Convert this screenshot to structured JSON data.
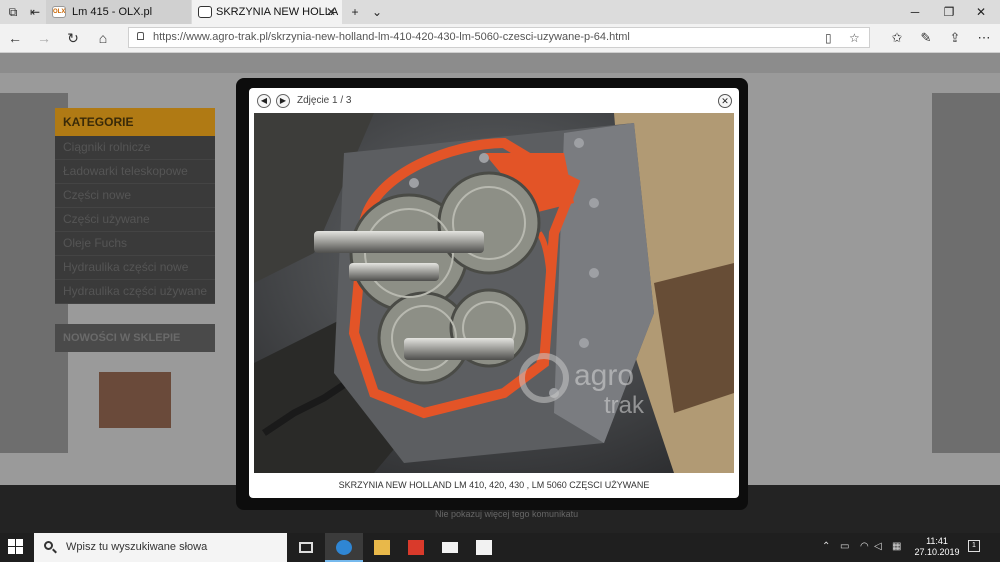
{
  "browser": {
    "tabs": [
      {
        "label": "Lm 415 - OLX.pl",
        "favicon": "OLX"
      },
      {
        "label": "SKRZYNIA NEW HOLLA"
      }
    ],
    "url": "https://www.agro-trak.pl/skrzynia-new-holland-lm-410-420-430-lm-5060-czesci-uzywane-p-64.html"
  },
  "page": {
    "categories_title": "KATEGORIE",
    "categories": [
      "Ciągniki rolnicze",
      "Ładowarki teleskopowe",
      "Części nowe",
      "Części używane",
      "Oleje Fuchs",
      "Hydraulika części nowe",
      "Hydraulika części używane"
    ],
    "news_title": "NOWOŚCI W SKLEPIE",
    "footer_text": "Nie pokazuj więcej tego komunikatu"
  },
  "lightbox": {
    "counter": "Zdjęcie 1 / 3",
    "caption": "SKRZYNIA NEW HOLLAND LM 410, 420, 430 , LM 5060 CZĘSCI UŻYWANE",
    "watermark_top": "agro",
    "watermark_bottom": "trak"
  },
  "taskbar": {
    "search_placeholder": "Wpisz tu wyszukiwane słowa",
    "time": "11:41",
    "date": "27.10.2019",
    "notification_count": "1"
  }
}
